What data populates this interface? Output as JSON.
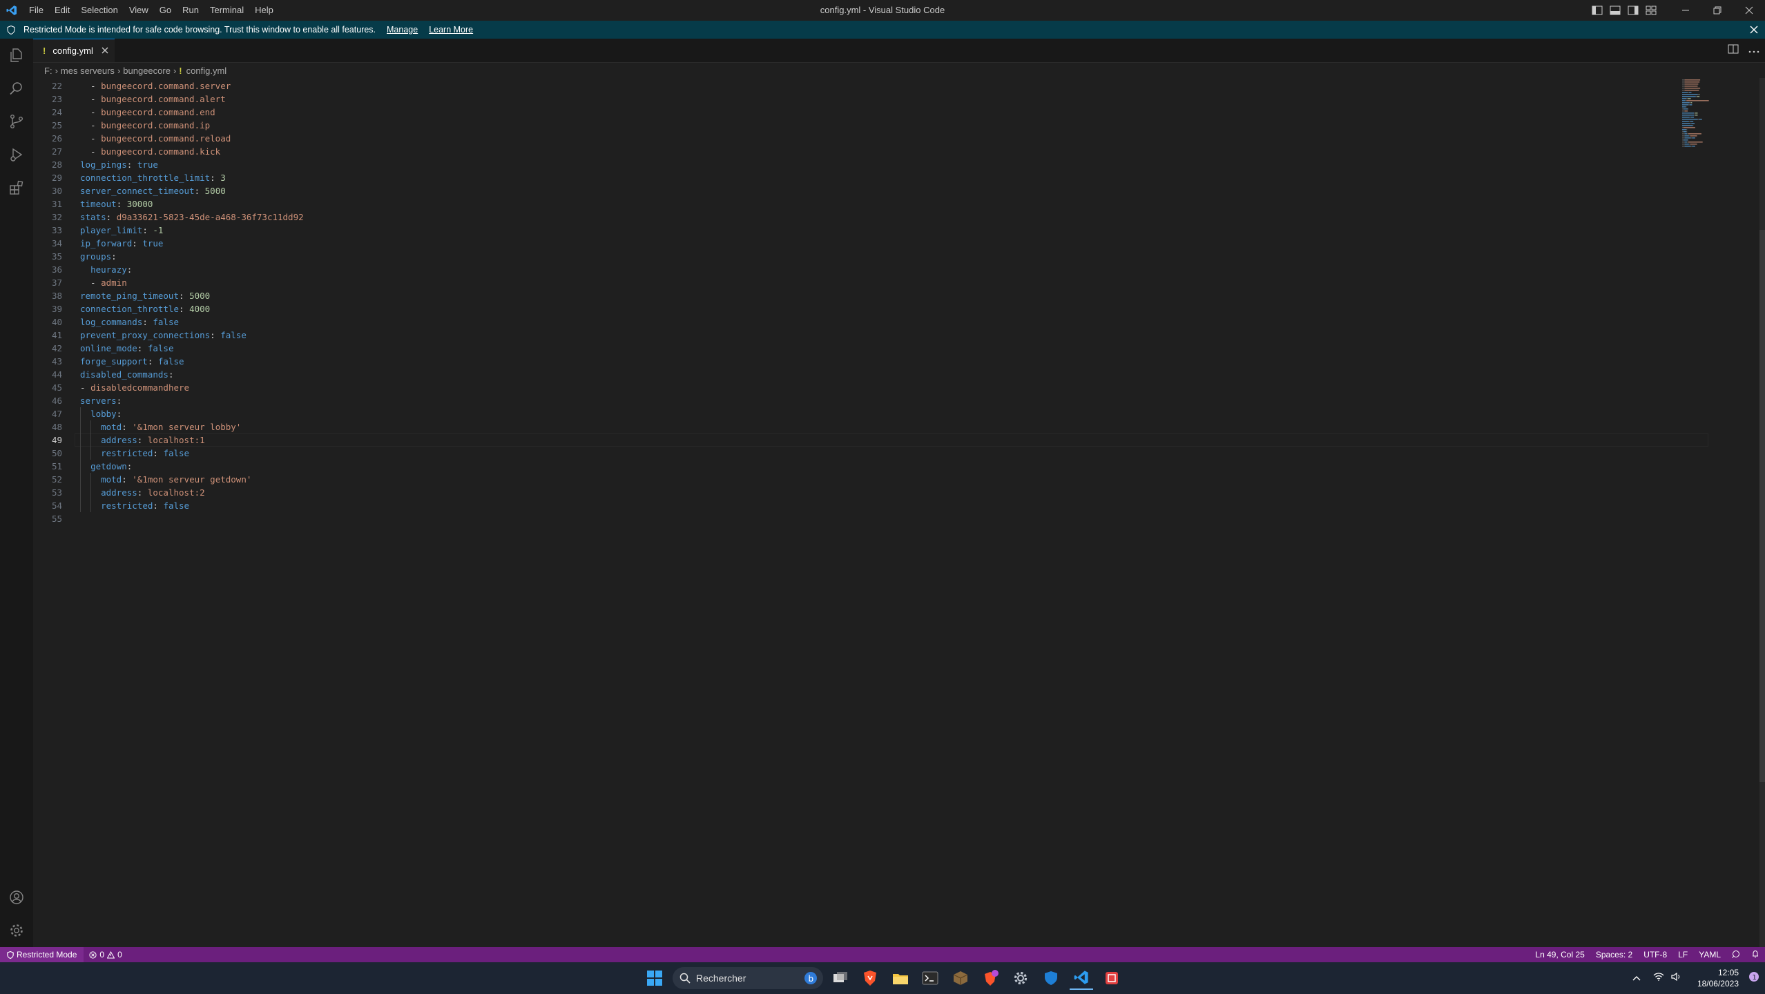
{
  "window": {
    "title": "config.yml - Visual Studio Code",
    "menu": [
      "File",
      "Edit",
      "Selection",
      "View",
      "Go",
      "Run",
      "Terminal",
      "Help"
    ]
  },
  "banner": {
    "message": "Restricted Mode is intended for safe code browsing. Trust this window to enable all features.",
    "manage": "Manage",
    "learn_more": "Learn More"
  },
  "tab": {
    "label": "config.yml",
    "icon": "!"
  },
  "breadcrumb": {
    "items": [
      "F:",
      "mes serveurs",
      "bungeecore"
    ],
    "file": "config.yml",
    "file_icon": "!"
  },
  "editor": {
    "cursor_line": 49,
    "lines": [
      {
        "n": "22",
        "t": [
          [
            "p",
            "  - "
          ],
          [
            "s",
            "bungeecord.command.server"
          ]
        ]
      },
      {
        "n": "23",
        "t": [
          [
            "p",
            "  - "
          ],
          [
            "s",
            "bungeecord.command.alert"
          ]
        ]
      },
      {
        "n": "24",
        "t": [
          [
            "p",
            "  - "
          ],
          [
            "s",
            "bungeecord.command.end"
          ]
        ]
      },
      {
        "n": "25",
        "t": [
          [
            "p",
            "  - "
          ],
          [
            "s",
            "bungeecord.command.ip"
          ]
        ]
      },
      {
        "n": "26",
        "t": [
          [
            "p",
            "  - "
          ],
          [
            "s",
            "bungeecord.command.reload"
          ]
        ]
      },
      {
        "n": "27",
        "t": [
          [
            "p",
            "  - "
          ],
          [
            "s",
            "bungeecord.command.kick"
          ]
        ]
      },
      {
        "n": "28",
        "t": [
          [
            "k",
            "log_pings"
          ],
          [
            "p",
            ": "
          ],
          [
            "k",
            "true"
          ]
        ]
      },
      {
        "n": "29",
        "t": [
          [
            "k",
            "connection_throttle_limit"
          ],
          [
            "p",
            ": "
          ],
          [
            "n",
            "3"
          ]
        ]
      },
      {
        "n": "30",
        "t": [
          [
            "k",
            "server_connect_timeout"
          ],
          [
            "p",
            ": "
          ],
          [
            "n",
            "5000"
          ]
        ]
      },
      {
        "n": "31",
        "t": [
          [
            "k",
            "timeout"
          ],
          [
            "p",
            ": "
          ],
          [
            "n",
            "30000"
          ]
        ]
      },
      {
        "n": "32",
        "t": [
          [
            "k",
            "stats"
          ],
          [
            "p",
            ": "
          ],
          [
            "s",
            "d9a33621-5823-45de-a468-36f73c11dd92"
          ]
        ]
      },
      {
        "n": "33",
        "t": [
          [
            "k",
            "player_limit"
          ],
          [
            "p",
            ": "
          ],
          [
            "n",
            "-1"
          ]
        ]
      },
      {
        "n": "34",
        "t": [
          [
            "k",
            "ip_forward"
          ],
          [
            "p",
            ": "
          ],
          [
            "k",
            "true"
          ]
        ]
      },
      {
        "n": "35",
        "t": [
          [
            "k",
            "groups"
          ],
          [
            "p",
            ":"
          ]
        ]
      },
      {
        "n": "36",
        "t": [
          [
            "p",
            "  "
          ],
          [
            "k",
            "heurazy"
          ],
          [
            "p",
            ":"
          ]
        ]
      },
      {
        "n": "37",
        "t": [
          [
            "p",
            "  - "
          ],
          [
            "s",
            "admin"
          ]
        ]
      },
      {
        "n": "38",
        "t": [
          [
            "k",
            "remote_ping_timeout"
          ],
          [
            "p",
            ": "
          ],
          [
            "n",
            "5000"
          ]
        ]
      },
      {
        "n": "39",
        "t": [
          [
            "k",
            "connection_throttle"
          ],
          [
            "p",
            ": "
          ],
          [
            "n",
            "4000"
          ]
        ]
      },
      {
        "n": "40",
        "t": [
          [
            "k",
            "log_commands"
          ],
          [
            "p",
            ": "
          ],
          [
            "k",
            "false"
          ]
        ]
      },
      {
        "n": "41",
        "t": [
          [
            "k",
            "prevent_proxy_connections"
          ],
          [
            "p",
            ": "
          ],
          [
            "k",
            "false"
          ]
        ]
      },
      {
        "n": "42",
        "t": [
          [
            "k",
            "online_mode"
          ],
          [
            "p",
            ": "
          ],
          [
            "k",
            "false"
          ]
        ]
      },
      {
        "n": "43",
        "t": [
          [
            "k",
            "forge_support"
          ],
          [
            "p",
            ": "
          ],
          [
            "k",
            "false"
          ]
        ]
      },
      {
        "n": "44",
        "t": [
          [
            "k",
            "disabled_commands"
          ],
          [
            "p",
            ":"
          ]
        ]
      },
      {
        "n": "45",
        "t": [
          [
            "p",
            "- "
          ],
          [
            "s",
            "disabledcommandhere"
          ]
        ]
      },
      {
        "n": "46",
        "t": [
          [
            "k",
            "servers"
          ],
          [
            "p",
            ":"
          ]
        ]
      },
      {
        "n": "47",
        "t": [
          [
            "p",
            "  "
          ],
          [
            "k",
            "lobby"
          ],
          [
            "p",
            ":"
          ]
        ]
      },
      {
        "n": "48",
        "t": [
          [
            "p",
            "    "
          ],
          [
            "k",
            "motd"
          ],
          [
            "p",
            ": "
          ],
          [
            "s",
            "'&1mon serveur lobby'"
          ]
        ]
      },
      {
        "n": "49",
        "t": [
          [
            "p",
            "    "
          ],
          [
            "k",
            "address"
          ],
          [
            "p",
            ": "
          ],
          [
            "s",
            "localhost:1"
          ]
        ]
      },
      {
        "n": "50",
        "t": [
          [
            "p",
            "    "
          ],
          [
            "k",
            "restricted"
          ],
          [
            "p",
            ": "
          ],
          [
            "k",
            "false"
          ]
        ]
      },
      {
        "n": "51",
        "t": [
          [
            "p",
            "  "
          ],
          [
            "k",
            "getdown"
          ],
          [
            "p",
            ":"
          ]
        ]
      },
      {
        "n": "52",
        "t": [
          [
            "p",
            "    "
          ],
          [
            "k",
            "motd"
          ],
          [
            "p",
            ": "
          ],
          [
            "s",
            "'&1mon serveur getdown'"
          ]
        ]
      },
      {
        "n": "53",
        "t": [
          [
            "p",
            "    "
          ],
          [
            "k",
            "address"
          ],
          [
            "p",
            ": "
          ],
          [
            "s",
            "localhost:2"
          ]
        ]
      },
      {
        "n": "54",
        "t": [
          [
            "p",
            "    "
          ],
          [
            "k",
            "restricted"
          ],
          [
            "p",
            ": "
          ],
          [
            "k",
            "false"
          ]
        ]
      },
      {
        "n": "55",
        "t": []
      }
    ]
  },
  "status": {
    "restricted": "Restricted Mode",
    "errors": "0",
    "warnings": "0",
    "position": "Ln 49, Col 25",
    "spaces": "Spaces: 2",
    "encoding": "UTF-8",
    "eol": "LF",
    "language": "YAML"
  },
  "taskbar": {
    "search_placeholder": "Rechercher",
    "time": "12:05",
    "date": "18/06/2023"
  },
  "colors": {
    "status_bar": "#6b1f7d",
    "banner": "#063b49",
    "yaml_key": "#569cd6",
    "yaml_string": "#ce9178",
    "yaml_number": "#b5cea8"
  }
}
